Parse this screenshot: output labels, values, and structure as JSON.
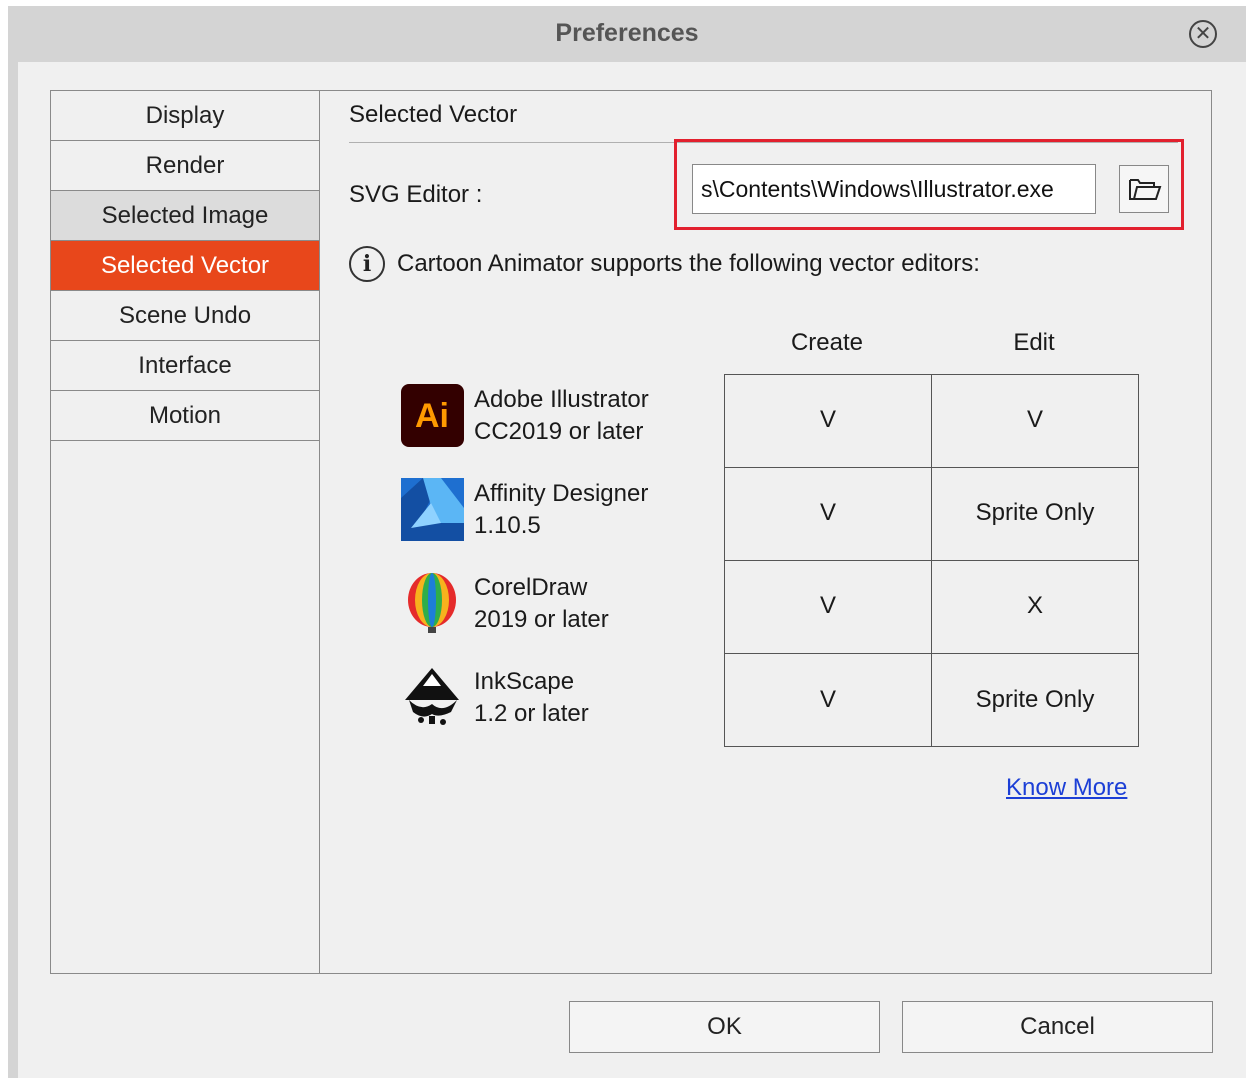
{
  "window": {
    "title": "Preferences"
  },
  "sidebar": {
    "items": [
      {
        "label": "Display",
        "state": "normal"
      },
      {
        "label": "Render",
        "state": "normal"
      },
      {
        "label": "Selected Image",
        "state": "hover"
      },
      {
        "label": "Selected Vector",
        "state": "active"
      },
      {
        "label": "Scene Undo",
        "state": "normal"
      },
      {
        "label": "Interface",
        "state": "normal"
      },
      {
        "label": "Motion",
        "state": "normal"
      }
    ]
  },
  "content": {
    "section_title": "Selected Vector",
    "svg_editor_label": "SVG Editor :",
    "svg_editor_path": "s\\Contents\\Windows\\Illustrator.exe",
    "info_text": "Cartoon Animator supports the following vector editors:",
    "columns": [
      "Create",
      "Edit"
    ],
    "editors": [
      {
        "name_line1": "Adobe Illustrator",
        "name_line2": "CC2019 or later",
        "create": "V",
        "edit": "V",
        "icon": "adobe-illustrator-icon"
      },
      {
        "name_line1": "Affinity Designer",
        "name_line2": "1.10.5",
        "create": "V",
        "edit": "Sprite Only",
        "icon": "affinity-designer-icon"
      },
      {
        "name_line1": "CorelDraw",
        "name_line2": "2019 or later",
        "create": "V",
        "edit": "X",
        "icon": "coreldraw-icon"
      },
      {
        "name_line1": "InkScape",
        "name_line2": "1.2 or later",
        "create": "V",
        "edit": "Sprite Only",
        "icon": "inkscape-icon"
      }
    ],
    "know_more": "Know More"
  },
  "buttons": {
    "ok": "OK",
    "cancel": "Cancel"
  },
  "colors": {
    "accent": "#e8471b",
    "highlight_border": "#e2202e",
    "link": "#1c3fd6"
  }
}
